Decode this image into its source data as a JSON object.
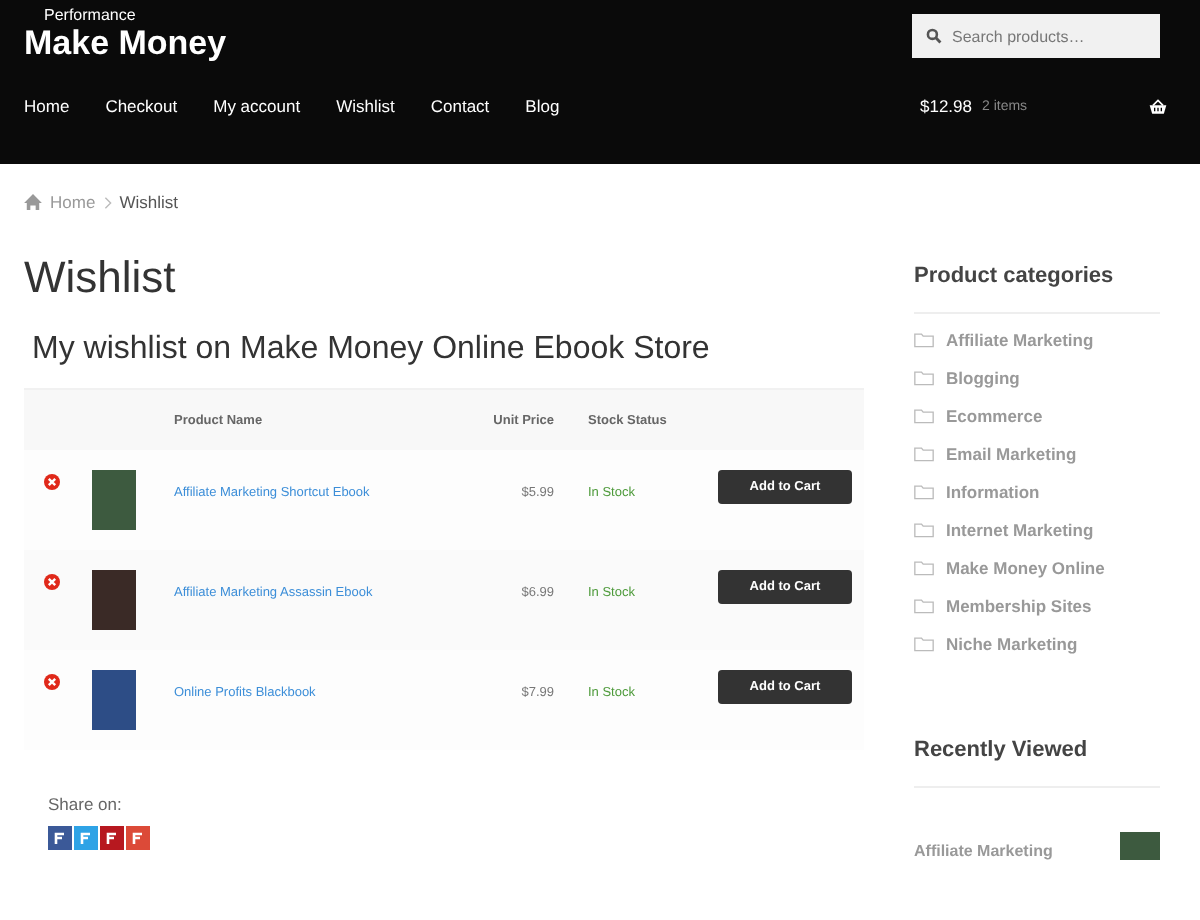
{
  "site": {
    "tagline": "Performance",
    "title": "Make Money"
  },
  "search": {
    "placeholder": "Search products…"
  },
  "nav": [
    "Home",
    "Checkout",
    "My account",
    "Wishlist",
    "Contact",
    "Blog"
  ],
  "cart": {
    "total": "$12.98",
    "count": "2 items"
  },
  "breadcrumb": [
    "Home",
    "Wishlist"
  ],
  "page_title": "Wishlist",
  "wishlist_title": "My wishlist on Make Money Online Ebook Store",
  "table": {
    "columns": [
      "Product Name",
      "Unit Price",
      "Stock Status"
    ],
    "rows": [
      {
        "name": "Affiliate Marketing Shortcut Ebook",
        "price": "$5.99",
        "stock": "In Stock",
        "button": "Add to Cart"
      },
      {
        "name": "Affiliate Marketing Assassin Ebook",
        "price": "$6.99",
        "stock": "In Stock",
        "button": "Add to Cart"
      },
      {
        "name": "Online Profits Blackbook",
        "price": "$7.99",
        "stock": "In Stock",
        "button": "Add to Cart"
      }
    ]
  },
  "share": {
    "label": "Share on:"
  },
  "sidebar": {
    "categories_title": "Product categories",
    "categories": [
      "Affiliate Marketing",
      "Blogging",
      "Ecommerce",
      "Email Marketing",
      "Information",
      "Internet Marketing",
      "Make Money Online",
      "Membership Sites",
      "Niche Marketing"
    ],
    "recent_title": "Recently Viewed",
    "recent": [
      "Affiliate Marketing"
    ]
  }
}
